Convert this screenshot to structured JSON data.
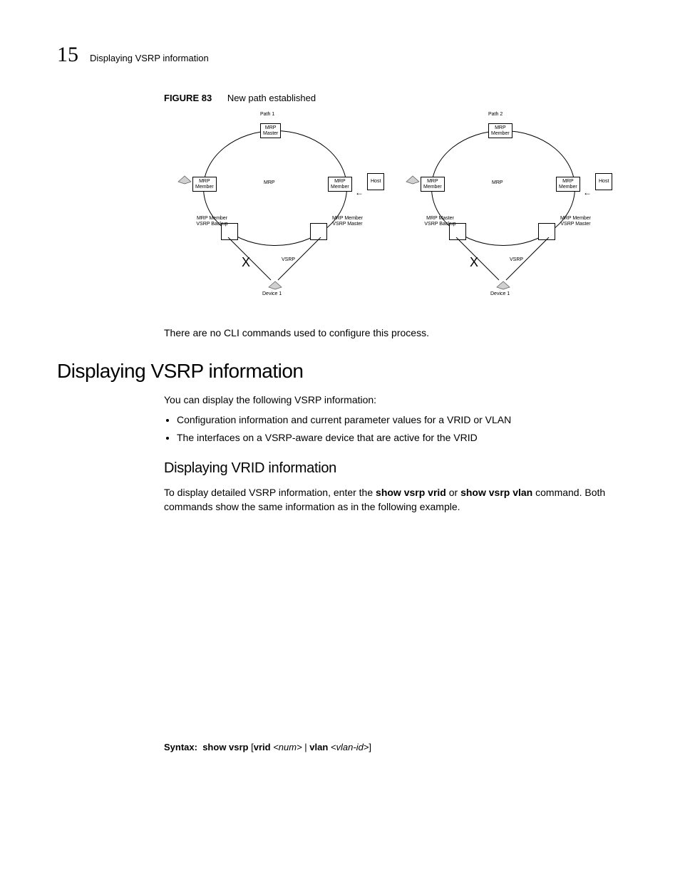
{
  "header": {
    "chapter": "15",
    "title": "Displaying VSRP information"
  },
  "figure": {
    "label": "FIGURE 83",
    "caption": "New path established",
    "ring_labels": {
      "path1": "Path 1",
      "path2": "Path 2",
      "mrp_master": "MRP\nMaster",
      "mrp_member": "MRP\nMember",
      "mrp": "MRP",
      "host": "Host",
      "mm_vb": "MRP Member\nVSRP Backup",
      "mm_vm": "MRP Member\nVSRP Master",
      "mmaster_vb": "MRP Master\nVSRP Backup",
      "vsrp": "VSRP",
      "device1": "Device 1",
      "x": "X"
    }
  },
  "after_figure": "There are no CLI commands used to configure this process.",
  "section": {
    "h1": "Displaying VSRP information",
    "intro": "You can display the following VSRP information:",
    "bullets": [
      "Configuration information and current parameter values for a VRID or VLAN",
      "The interfaces on a VSRP-aware device that are active for the VRID"
    ],
    "h2": "Displaying VRID information",
    "p2a": "To display detailed VSRP information, enter the ",
    "cmd1": "show vsrp vrid",
    "p2b": " or ",
    "cmd2": "show vsrp vlan",
    "p2c": " command. Both commands show the same information as in the following example."
  },
  "syntax": {
    "label": "Syntax:",
    "cmd": "show vsrp",
    "open": " [",
    "k1": "vrid ",
    "a1": "<num>",
    "sep": " | ",
    "k2": "vlan ",
    "a2": "<vlan-id>",
    "close": "]"
  }
}
